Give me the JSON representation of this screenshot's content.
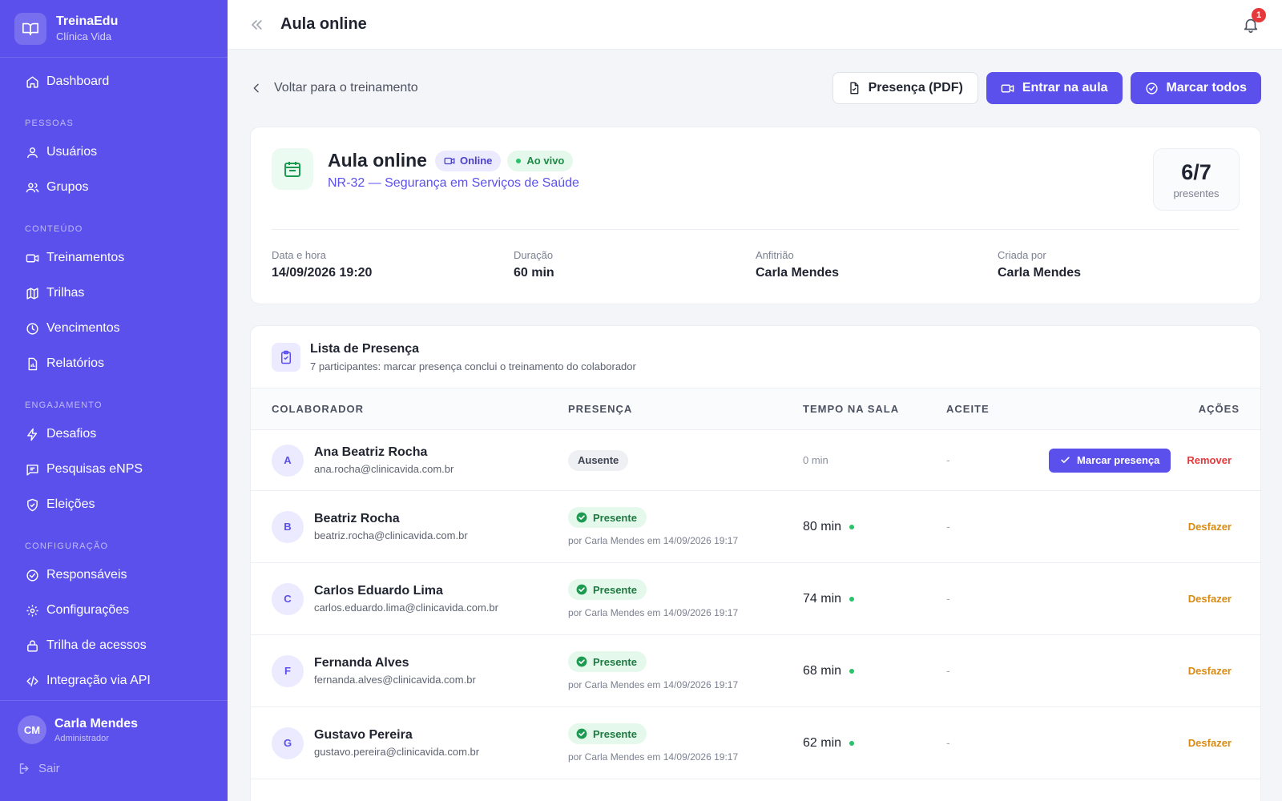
{
  "brand": {
    "name": "TreinaEdu",
    "subtitle": "Clínica Vida"
  },
  "sidebar": {
    "dashboard": "Dashboard",
    "sections": {
      "people": "PESSOAS",
      "content": "CONTEÚDO",
      "engagement": "ENGAJAMENTO",
      "config": "CONFIGURAÇÃO"
    },
    "items": {
      "usuarios": "Usuários",
      "grupos": "Grupos",
      "treinamentos": "Treinamentos",
      "trilhas": "Trilhas",
      "vencimentos": "Vencimentos",
      "relatorios": "Relatórios",
      "desafios": "Desafios",
      "pesquisas": "Pesquisas eNPS",
      "eleicoes": "Eleições",
      "responsaveis": "Responsáveis",
      "configuracoes": "Configurações",
      "trilha_acessos": "Trilha de acessos",
      "api": "Integração via API"
    },
    "user": {
      "initials": "CM",
      "name": "Carla Mendes",
      "role": "Administrador"
    },
    "logout": "Sair"
  },
  "topbar": {
    "title": "Aula online",
    "notifications": "1"
  },
  "actionbar": {
    "back": "Voltar para o treinamento",
    "pdf": "Presença (PDF)",
    "enter": "Entrar na aula",
    "mark_all": "Marcar todos"
  },
  "session": {
    "title": "Aula online",
    "tag_online": "Online",
    "tag_live": "Ao vivo",
    "course": "NR-32 — Segurança em Serviços de Saúde",
    "count": "6/7",
    "count_label": "presentes",
    "meta": [
      {
        "label": "Data e hora",
        "value": "14/09/2026 19:20"
      },
      {
        "label": "Duração",
        "value": "60 min"
      },
      {
        "label": "Anfitrião",
        "value": "Carla Mendes"
      },
      {
        "label": "Criada por",
        "value": "Carla Mendes"
      }
    ]
  },
  "attendance": {
    "title": "Lista de Presença",
    "subtitle": "7 participantes: marcar presença conclui o treinamento do colaborador",
    "columns": {
      "employee": "COLABORADOR",
      "presence": "PRESENÇA",
      "time": "TEMPO NA SALA",
      "accept": "ACEITE",
      "actions": "AÇÕES"
    },
    "rows": [
      {
        "initial": "A",
        "name": "Ana Beatriz Rocha",
        "email": "ana.rocha@clinicavida.com.br",
        "status": "Ausente",
        "by": "",
        "time": "0 min",
        "accept": "-",
        "primary_action": "Marcar presença",
        "secondary_action": "Remover"
      },
      {
        "initial": "B",
        "name": "Beatriz Rocha",
        "email": "beatriz.rocha@clinicavida.com.br",
        "status": "Presente",
        "by": "por Carla Mendes em 14/09/2026 19:17",
        "time": "80 min",
        "accept": "-",
        "secondary_action": "Desfazer"
      },
      {
        "initial": "C",
        "name": "Carlos Eduardo Lima",
        "email": "carlos.eduardo.lima@clinicavida.com.br",
        "status": "Presente",
        "by": "por Carla Mendes em 14/09/2026 19:17",
        "time": "74 min",
        "accept": "-",
        "secondary_action": "Desfazer"
      },
      {
        "initial": "F",
        "name": "Fernanda Alves",
        "email": "fernanda.alves@clinicavida.com.br",
        "status": "Presente",
        "by": "por Carla Mendes em 14/09/2026 19:17",
        "time": "68 min",
        "accept": "-",
        "secondary_action": "Desfazer"
      },
      {
        "initial": "G",
        "name": "Gustavo Pereira",
        "email": "gustavo.pereira@clinicavida.com.br",
        "status": "Presente",
        "by": "por Carla Mendes em 14/09/2026 19:17",
        "time": "62 min",
        "accept": "-",
        "secondary_action": "Desfazer"
      }
    ]
  },
  "colors": {
    "primary": "#5b50ec",
    "success": "#28c26a",
    "danger": "#e5383b",
    "warning": "#d98a12"
  }
}
